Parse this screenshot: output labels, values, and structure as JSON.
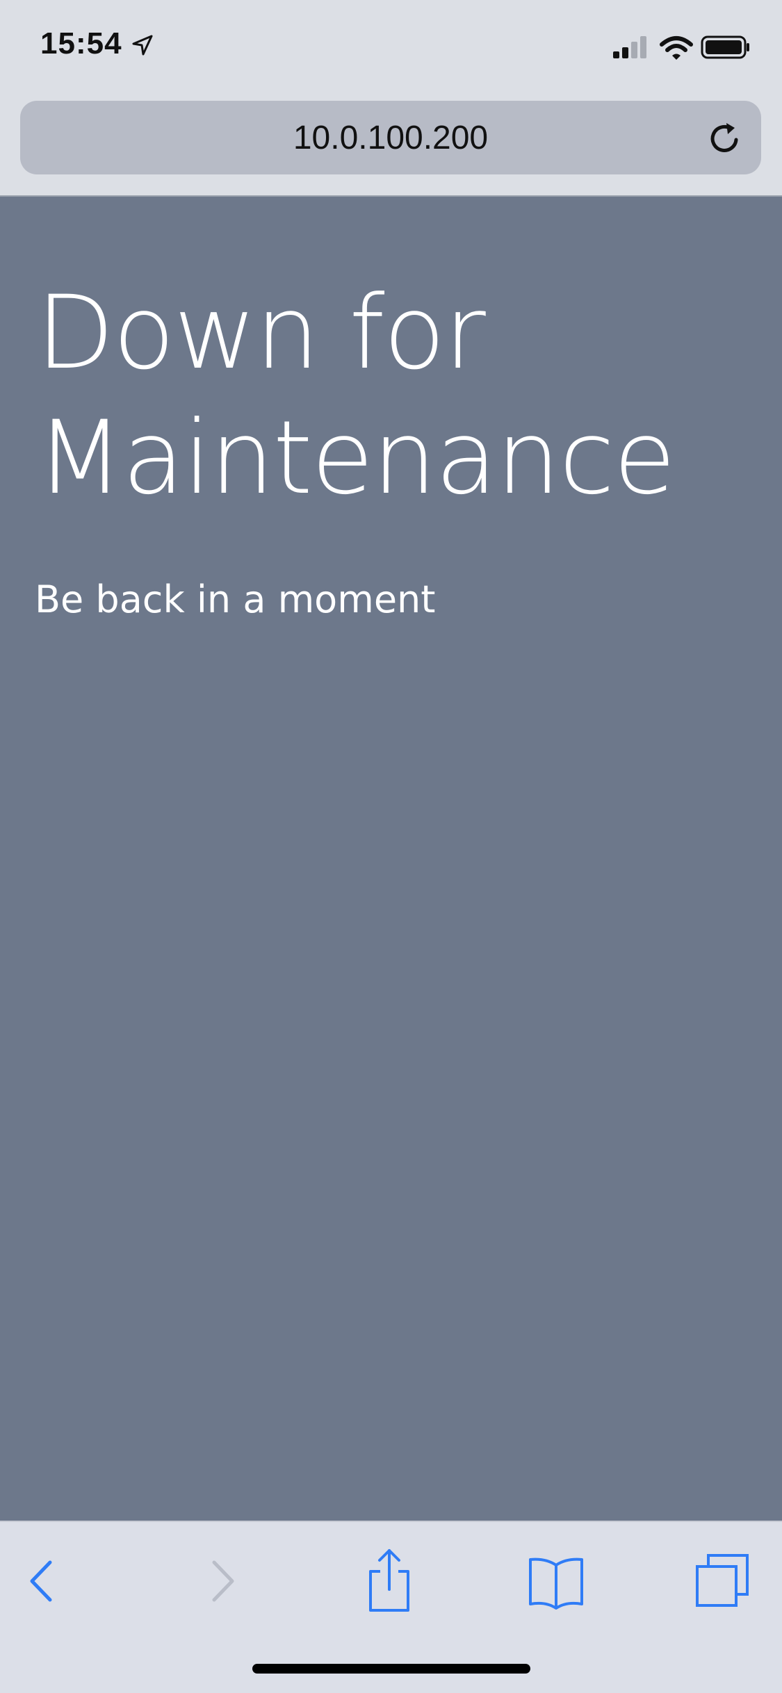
{
  "status_bar": {
    "time": "15:54",
    "icons": [
      "location-arrow-icon",
      "signal-icon",
      "wifi-icon",
      "battery-icon"
    ]
  },
  "address_bar": {
    "url": "10.0.100.200",
    "reload_icon": "reload-icon"
  },
  "page": {
    "heading": "Down for Maintenance",
    "subtext": "Be back in a moment",
    "background_color": "#6d788b",
    "text_color": "#ffffff"
  },
  "toolbar": {
    "accent_color": "#2f7cf6",
    "disabled_color": "#b9bdc8",
    "buttons": [
      "back-icon",
      "forward-icon",
      "share-icon",
      "bookmarks-icon",
      "tabs-icon"
    ]
  }
}
